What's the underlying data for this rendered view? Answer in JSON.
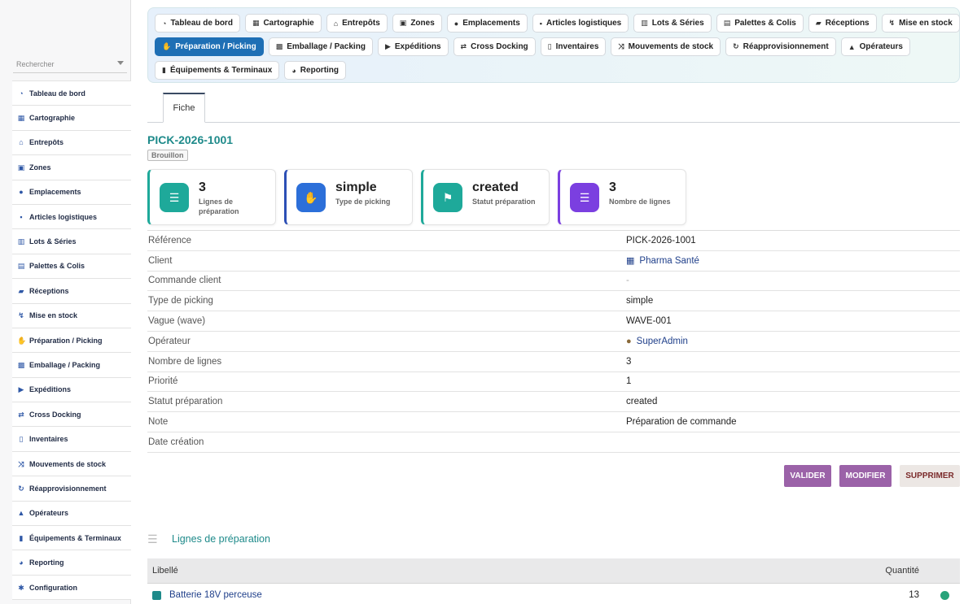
{
  "sidebar": {
    "search_placeholder": "Rechercher",
    "items": [
      {
        "label": "Tableau de bord",
        "icon": "dashboard-icon"
      },
      {
        "label": "Cartographie",
        "icon": "map-icon"
      },
      {
        "label": "Entrepôts",
        "icon": "warehouse-icon"
      },
      {
        "label": "Zones",
        "icon": "grid-icon"
      },
      {
        "label": "Emplacements",
        "icon": "location-icon"
      },
      {
        "label": "Articles logistiques",
        "icon": "box-icon"
      },
      {
        "label": "Lots & Séries",
        "icon": "barcode-icon"
      },
      {
        "label": "Palettes & Colis",
        "icon": "pallet-icon"
      },
      {
        "label": "Réceptions",
        "icon": "truck-loading-icon"
      },
      {
        "label": "Mise en stock",
        "icon": "dolly-icon"
      },
      {
        "label": "Préparation / Picking",
        "icon": "hand-icon"
      },
      {
        "label": "Emballage / Packing",
        "icon": "boxes-icon"
      },
      {
        "label": "Expéditions",
        "icon": "truck-icon"
      },
      {
        "label": "Cross Docking",
        "icon": "exchange-icon"
      },
      {
        "label": "Inventaires",
        "icon": "clipboard-icon"
      },
      {
        "label": "Mouvements de stock",
        "icon": "shuffle-icon"
      },
      {
        "label": "Réapprovisionnement",
        "icon": "sync-icon"
      },
      {
        "label": "Opérateurs",
        "icon": "operator-icon"
      },
      {
        "label": "Équipements & Terminaux",
        "icon": "mobile-icon"
      },
      {
        "label": "Reporting",
        "icon": "pie-chart-icon"
      },
      {
        "label": "Configuration",
        "icon": "gear-icon"
      }
    ]
  },
  "topnav": {
    "rows": [
      [
        {
          "label": "Tableau de bord",
          "icon": "dashboard-icon",
          "active": false
        },
        {
          "label": "Cartographie",
          "icon": "map-icon",
          "active": false
        },
        {
          "label": "Entrepôts",
          "icon": "warehouse-icon",
          "active": false
        },
        {
          "label": "Zones",
          "icon": "grid-icon",
          "active": false
        },
        {
          "label": "Emplacements",
          "icon": "location-icon",
          "active": false
        },
        {
          "label": "Articles logistiques",
          "icon": "box-icon",
          "active": false
        },
        {
          "label": "Lots & Séries",
          "icon": "barcode-icon",
          "active": false
        },
        {
          "label": "Palettes & Colis",
          "icon": "pallet-icon",
          "active": false
        },
        {
          "label": "Réceptions",
          "icon": "truck-loading-icon",
          "active": false
        },
        {
          "label": "Mise en stock",
          "icon": "dolly-icon",
          "active": false
        }
      ],
      [
        {
          "label": "Préparation / Picking",
          "icon": "hand-icon",
          "active": true
        },
        {
          "label": "Emballage / Packing",
          "icon": "boxes-icon",
          "active": false
        },
        {
          "label": "Expéditions",
          "icon": "truck-icon",
          "active": false
        },
        {
          "label": "Cross Docking",
          "icon": "exchange-icon",
          "active": false
        },
        {
          "label": "Inventaires",
          "icon": "clipboard-icon",
          "active": false
        },
        {
          "label": "Mouvements de stock",
          "icon": "shuffle-icon",
          "active": false
        },
        {
          "label": "Réapprovisionnement",
          "icon": "sync-icon",
          "active": false
        },
        {
          "label": "Opérateurs",
          "icon": "operator-icon",
          "active": false
        }
      ],
      [
        {
          "label": "Équipements & Terminaux",
          "icon": "mobile-icon",
          "active": false
        },
        {
          "label": "Reporting",
          "icon": "pie-chart-icon",
          "active": false
        }
      ]
    ]
  },
  "tabs": {
    "fiche": "Fiche"
  },
  "record": {
    "title": "PICK-2026-1001",
    "status": "Brouillon"
  },
  "kpis": [
    {
      "value": "3",
      "label": "Lignes de préparation",
      "icon": "list-icon",
      "color": "#1ea99a",
      "border": "#1ea99a"
    },
    {
      "value": "simple",
      "label": "Type de picking",
      "icon": "hand-icon",
      "color": "#2c6fd9",
      "border": "#2c4fb5"
    },
    {
      "value": "created",
      "label": "Statut préparation",
      "icon": "flag-icon",
      "color": "#1ea99a",
      "border": "#1ea99a"
    },
    {
      "value": "3",
      "label": "Nombre de lignes",
      "icon": "list-icon",
      "color": "#7b3fe0",
      "border": "#7b3fe0"
    }
  ],
  "details": [
    {
      "key": "Référence",
      "value": "PICK-2026-1001",
      "style": "plain",
      "icon": ""
    },
    {
      "key": "Client",
      "value": "Pharma Santé",
      "style": "link",
      "icon": "building-icon"
    },
    {
      "key": "Commande client",
      "value": "-",
      "style": "muted",
      "icon": ""
    },
    {
      "key": "Type de picking",
      "value": "simple",
      "style": "plain",
      "icon": ""
    },
    {
      "key": "Vague (wave)",
      "value": "WAVE-001",
      "style": "plain",
      "icon": ""
    },
    {
      "key": "Opérateur",
      "value": "SuperAdmin",
      "style": "link",
      "icon": "user-icon"
    },
    {
      "key": "Nombre de lignes",
      "value": "3",
      "style": "plain",
      "icon": ""
    },
    {
      "key": "Priorité",
      "value": "1",
      "style": "plain",
      "icon": ""
    },
    {
      "key": "Statut préparation",
      "value": "created",
      "style": "plain",
      "icon": ""
    },
    {
      "key": "Note",
      "value": "Préparation de commande",
      "style": "plain",
      "icon": ""
    },
    {
      "key": "Date création",
      "value": "",
      "style": "plain",
      "icon": ""
    }
  ],
  "actions": {
    "validate": "VALIDER",
    "modify": "MODIFIER",
    "delete": "SUPPRIMER"
  },
  "lines": {
    "title": "Lignes de préparation",
    "columns": [
      "Libellé",
      "Quantité"
    ],
    "rows": [
      {
        "label": "Batterie 18V perceuse",
        "qty": "13",
        "status_color": "#27a37a"
      }
    ]
  },
  "colors": {
    "accent": "#1e6fb5",
    "title": "#1e8a8a",
    "btn_purple": "#9b62a8",
    "btn_delete_bg": "#ece7e4",
    "btn_delete_text": "#7a2a2a"
  }
}
